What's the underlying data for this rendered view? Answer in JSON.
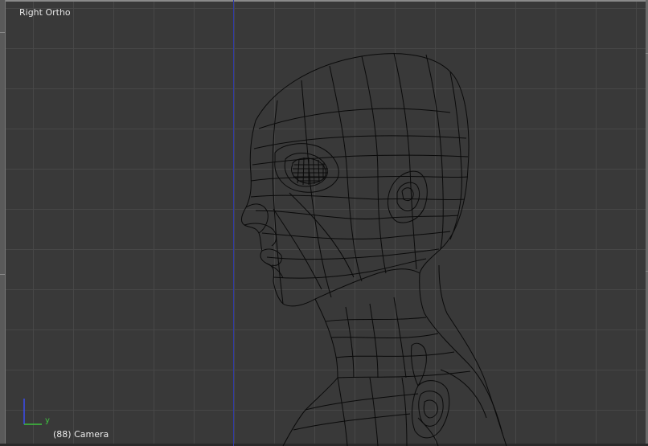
{
  "viewport": {
    "view_label": "Right Ortho",
    "object_label": "(88) Camera"
  },
  "gizmo": {
    "y_label": "y",
    "y_color": "#3ec23e",
    "z_color": "#3a4cf0"
  },
  "colors": {
    "background": "#393939",
    "grid": "#484848",
    "wireframe": "#0a0a0a",
    "z_axis": "#2f3aa8"
  },
  "icons": [
    "axis-gizmo-icon"
  ]
}
